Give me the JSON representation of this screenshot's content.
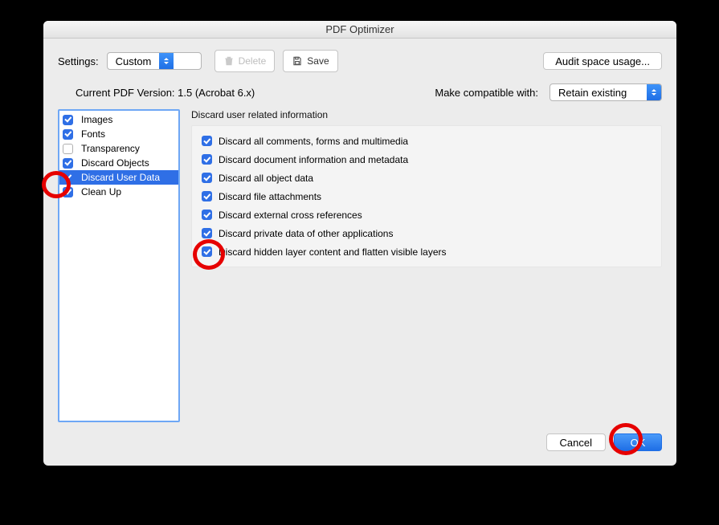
{
  "window": {
    "title": "PDF Optimizer"
  },
  "toolbar": {
    "settings_label": "Settings:",
    "settings_value": "Custom",
    "delete_label": "Delete",
    "save_label": "Save",
    "audit_label": "Audit space usage..."
  },
  "info_row": {
    "version_label": "Current PDF Version: 1.5 (Acrobat 6.x)",
    "compat_label": "Make compatible with:",
    "compat_value": "Retain existing"
  },
  "sidebar": {
    "items": [
      {
        "label": "Images",
        "checked": true
      },
      {
        "label": "Fonts",
        "checked": true
      },
      {
        "label": "Transparency",
        "checked": false
      },
      {
        "label": "Discard Objects",
        "checked": true
      },
      {
        "label": "Discard User Data",
        "checked": true,
        "selected": true
      },
      {
        "label": "Clean Up",
        "checked": true
      }
    ]
  },
  "pane": {
    "title": "Discard user related information",
    "options": [
      {
        "label": "Discard all comments, forms and multimedia",
        "checked": true
      },
      {
        "label": "Discard document information and metadata",
        "checked": true
      },
      {
        "label": "Discard all object data",
        "checked": true
      },
      {
        "label": "Discard file attachments",
        "checked": true
      },
      {
        "label": "Discard external cross references",
        "checked": true
      },
      {
        "label": "Discard private data of other applications",
        "checked": true
      },
      {
        "label": "Discard hidden layer content and flatten visible layers",
        "checked": true
      }
    ]
  },
  "footer": {
    "cancel_label": "Cancel",
    "ok_label": "OK"
  }
}
